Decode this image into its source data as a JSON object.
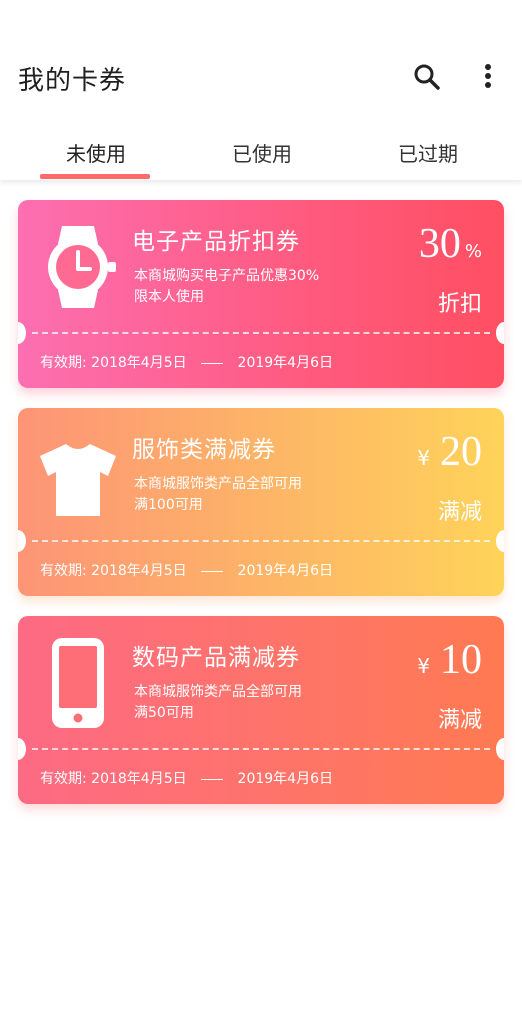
{
  "header": {
    "title": "我的卡券"
  },
  "tabs": [
    {
      "label": "未使用",
      "active": true
    },
    {
      "label": "已使用",
      "active": false
    },
    {
      "label": "已过期",
      "active": false
    }
  ],
  "colors": {
    "accent": "#ff6b6b"
  },
  "coupons": [
    {
      "icon": "watch-icon",
      "title": "电子产品折扣券",
      "desc_line1": "本商城购买电子产品优惠30%",
      "desc_line2": "限本人使用",
      "currency": "",
      "value": "30",
      "unit": "%",
      "type": "折扣",
      "valid_label": "有效期:",
      "valid_from": "2018年4月5日",
      "valid_to": "2019年4月6日"
    },
    {
      "icon": "tshirt-icon",
      "title": "服饰类满减券",
      "desc_line1": "本商城服饰类产品全部可用",
      "desc_line2": "满100可用",
      "currency": "¥",
      "value": "20",
      "unit": "",
      "type": "满减",
      "valid_label": "有效期:",
      "valid_from": "2018年4月5日",
      "valid_to": "2019年4月6日"
    },
    {
      "icon": "phone-icon",
      "title": "数码产品满减券",
      "desc_line1": "本商城服饰类产品全部可用",
      "desc_line2": "满50可用",
      "currency": "¥",
      "value": "10",
      "unit": "",
      "type": "满减",
      "valid_label": "有效期:",
      "valid_from": "2018年4月5日",
      "valid_to": "2019年4月6日"
    }
  ]
}
